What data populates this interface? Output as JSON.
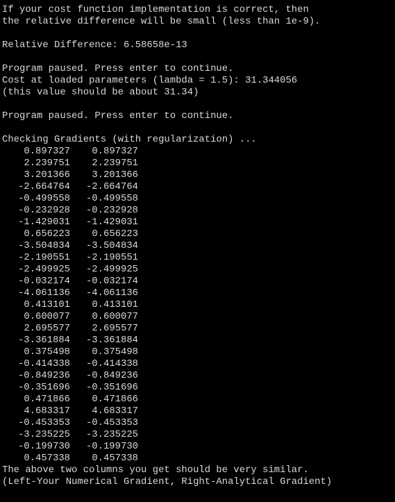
{
  "terminal": {
    "bg_color": "#000000",
    "text_color": "#d9d9d9",
    "intro_lines": [
      "If your cost function implementation is correct, then",
      "the relative difference will be small (less than 1e-9)."
    ],
    "relative_difference_line": "Relative Difference: 6.58658e-13",
    "pause_1": "Program paused. Press enter to continue.",
    "cost_line": "Cost at loaded parameters (lambda = 1.5): 31.344056",
    "cost_note": "(this value should be about 31.34)",
    "pause_2": "Program paused. Press enter to continue.",
    "checking_line": "Checking Gradients (with regularization) ...",
    "gradients": [
      [
        "0.897327",
        "0.897327"
      ],
      [
        "2.239751",
        "2.239751"
      ],
      [
        "3.201366",
        "3.201366"
      ],
      [
        "-2.664764",
        "-2.664764"
      ],
      [
        "-0.499558",
        "-0.499558"
      ],
      [
        "-0.232928",
        "-0.232928"
      ],
      [
        "-1.429031",
        "-1.429031"
      ],
      [
        "0.656223",
        "0.656223"
      ],
      [
        "-3.504834",
        "-3.504834"
      ],
      [
        "-2.190551",
        "-2.190551"
      ],
      [
        "-2.499925",
        "-2.499925"
      ],
      [
        "-0.032174",
        "-0.032174"
      ],
      [
        "-4.061136",
        "-4.061136"
      ],
      [
        "0.413101",
        "0.413101"
      ],
      [
        "0.600077",
        "0.600077"
      ],
      [
        "2.695577",
        "2.695577"
      ],
      [
        "-3.361884",
        "-3.361884"
      ],
      [
        "0.375498",
        "0.375498"
      ],
      [
        "-0.414338",
        "-0.414338"
      ],
      [
        "-0.849236",
        "-0.849236"
      ],
      [
        "-0.351696",
        "-0.351696"
      ],
      [
        "0.471866",
        "0.471866"
      ],
      [
        "4.683317",
        "4.683317"
      ],
      [
        "-0.453353",
        "-0.453353"
      ],
      [
        "-3.235225",
        "-3.235225"
      ],
      [
        "-0.199730",
        "-0.199730"
      ],
      [
        "0.457338",
        "0.457338"
      ]
    ],
    "footer_lines": [
      "The above two columns you get should be very similar.",
      "(Left-Your Numerical Gradient, Right-Analytical Gradient)"
    ]
  }
}
